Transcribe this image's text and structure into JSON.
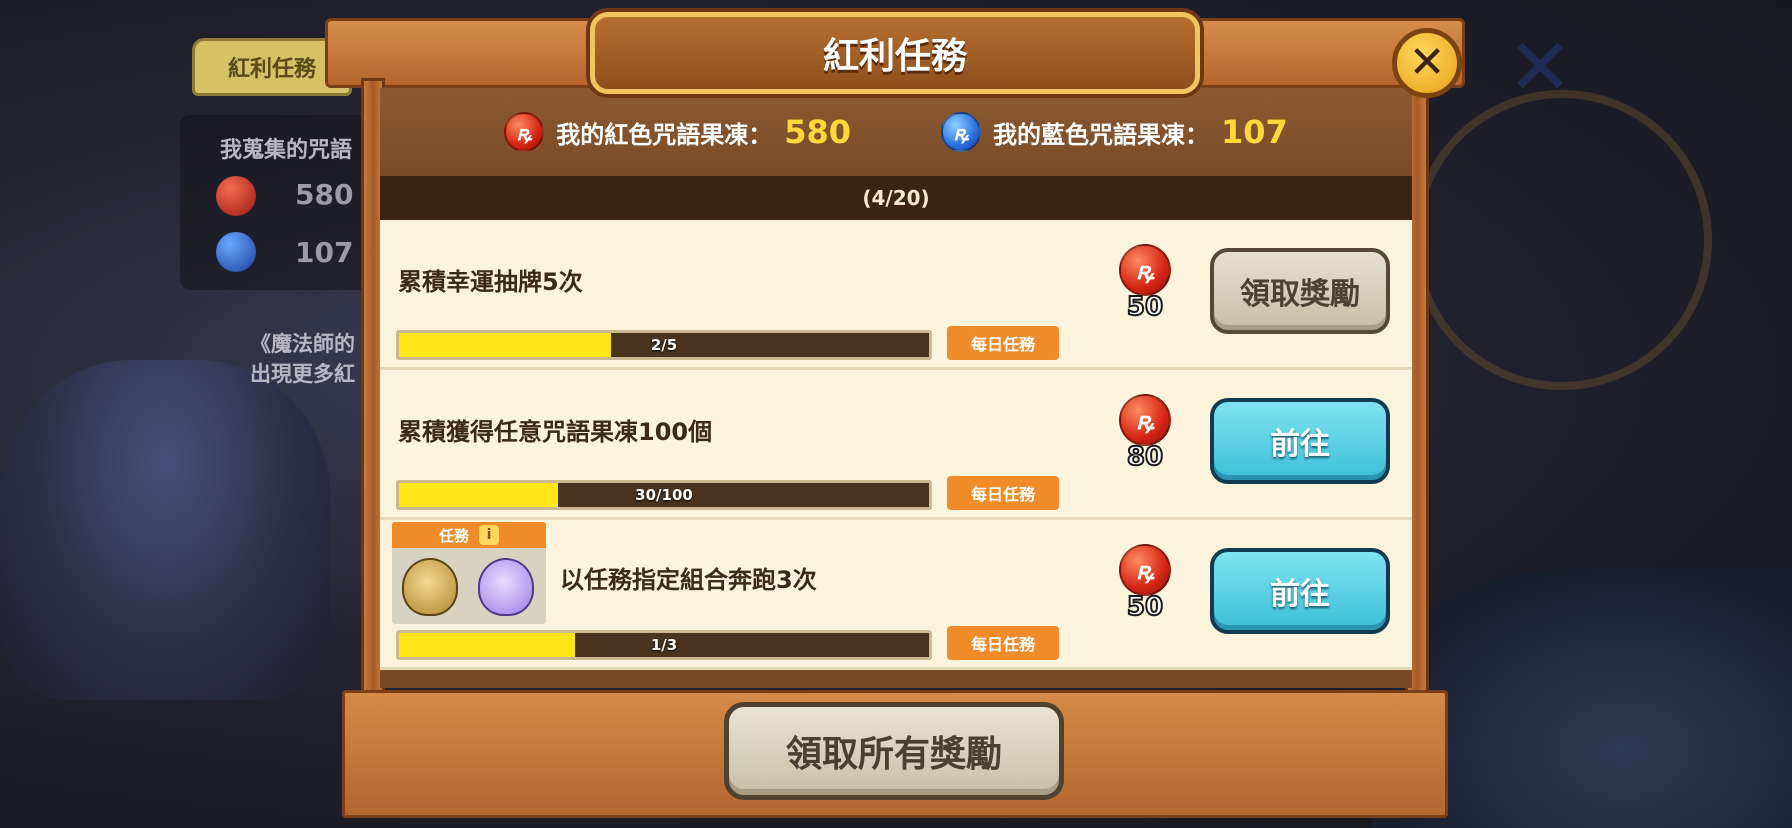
{
  "background": {
    "tab_label": "紅利任務",
    "collected_label": "我蒐集的咒語",
    "red_count": "580",
    "blue_count": "107",
    "note_line1": "《魔法師的",
    "note_line2": "出現更多紅"
  },
  "dialog": {
    "title": "紅利任務",
    "red_label": "我的紅色咒語果凍：",
    "red_value": "580",
    "blue_label": "我的藍色咒語果凍：",
    "blue_value": "107",
    "progress": "(4/20)",
    "claim_all_label": "領取所有獎勵",
    "close_icon": "close-icon"
  },
  "tasks": [
    {
      "title": "累積幸運抽牌5次",
      "progress_text": "2/5",
      "progress_fraction": 0.4,
      "tag": "每日任務",
      "reward_value": "50",
      "button_label": "領取獎勵",
      "button_type": "claim"
    },
    {
      "title": "累積獲得任意咒語果凍100個",
      "progress_text": "30/100",
      "progress_fraction": 0.3,
      "tag": "每日任務",
      "reward_value": "80",
      "button_label": "前往",
      "button_type": "go"
    },
    {
      "title": "以任務指定組合奔跑3次",
      "progress_text": "1/3",
      "progress_fraction": 0.333,
      "tag": "每日任務",
      "reward_value": "50",
      "button_label": "前往",
      "button_type": "go",
      "mission_label": "任務",
      "mission_info": "i"
    }
  ],
  "colors": {
    "accent_orange": "#f08b2a",
    "progress_yellow": "#ffe51a",
    "value_yellow": "#ffd93a"
  }
}
